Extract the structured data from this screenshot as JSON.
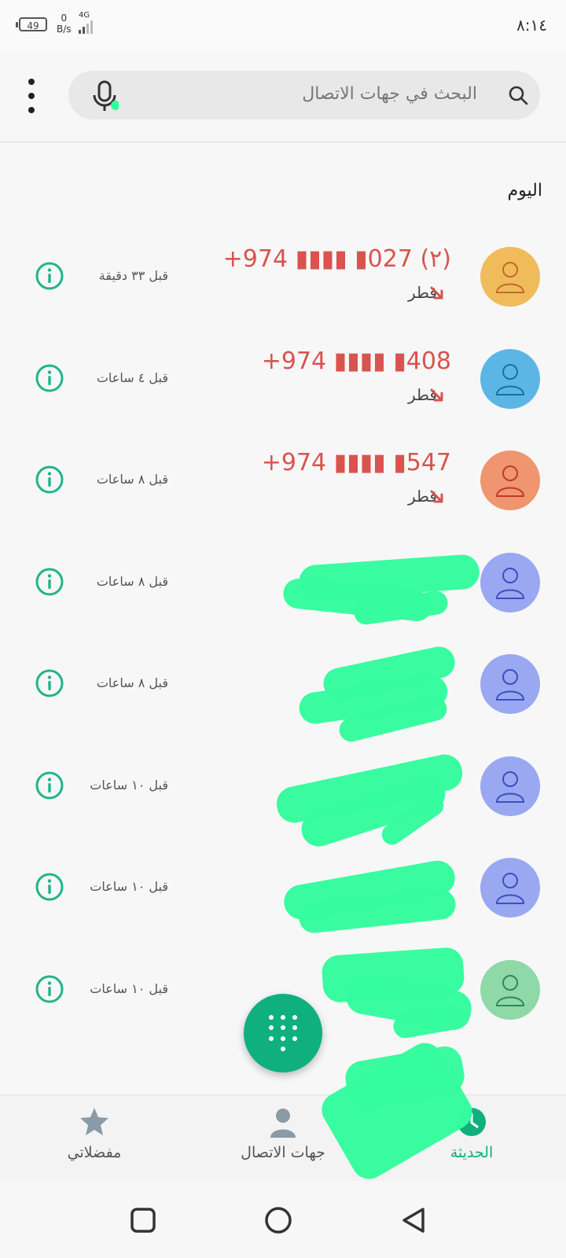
{
  "status_bar": {
    "battery": "49",
    "speed_value": "0",
    "speed_unit": "B/s",
    "network": "4G",
    "time": "٨:١٤"
  },
  "search": {
    "placeholder": "البحث في جهات الاتصال"
  },
  "section_header": "اليوم",
  "calls": [
    {
      "number": "+974 ▮▮▮▮ ▮027 (٢)",
      "subtitle": "قطر",
      "time": "قبل ٣٣ دقيقة",
      "avatar_color": "#f0bb5b",
      "icon_color": "#c46a2a",
      "missed": true
    },
    {
      "number": "+974 ▮▮▮▮ ▮408",
      "subtitle": "قطر",
      "time": "قبل ٤ ساعات",
      "avatar_color": "#5bb6e6",
      "icon_color": "#1f6f9d",
      "missed": true
    },
    {
      "number": "+974 ▮▮▮▮ ▮547",
      "subtitle": "قطر",
      "time": "قبل ٨ ساعات",
      "avatar_color": "#ef9570",
      "icon_color": "#c0392b",
      "missed": true
    },
    {
      "time": "قبل ٨ ساعات",
      "avatar_color": "#9aa8f2",
      "icon_color": "#3c4fbf"
    },
    {
      "time": "قبل ٨ ساعات",
      "avatar_color": "#9aa8f2",
      "icon_color": "#3c4fbf"
    },
    {
      "time": "قبل ١٠ ساعات",
      "avatar_color": "#9aa8f2",
      "icon_color": "#3c4fbf"
    },
    {
      "time": "قبل ١٠ ساعات",
      "avatar_color": "#9aa8f2",
      "icon_color": "#3c4fbf"
    },
    {
      "time": "قبل ١٠ ساعات",
      "avatar_color": "#8fd8a8",
      "icon_color": "#2f8a55"
    }
  ],
  "bottom_nav": {
    "recent": "الحديثة",
    "contacts": "جهات الاتصال",
    "favorites": "مفضلاتي"
  },
  "colors": {
    "accent": "#0fb07d",
    "missed": "#d9534f",
    "info": "#1fb587",
    "redaction": "#35fc9e"
  }
}
